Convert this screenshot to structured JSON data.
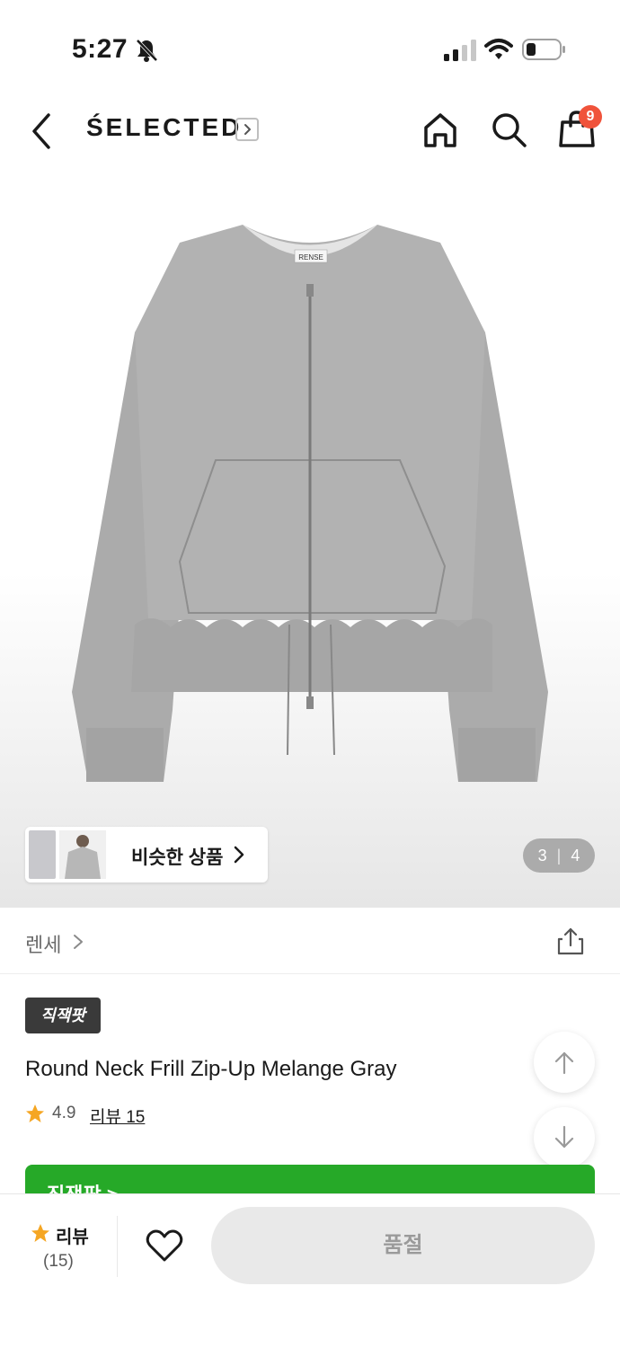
{
  "status_bar": {
    "time": "5:27"
  },
  "header": {
    "brand": "ŚELECTED",
    "cart_count": "9"
  },
  "gallery": {
    "similar_label": "비슷한 상품",
    "current": "3",
    "total": "4",
    "product_label_tag": "RENSE"
  },
  "brand_row": {
    "name": "렌세"
  },
  "product": {
    "tag": "직잭팟",
    "title": "Round Neck Frill Zip-Up Melange Gray",
    "rating": "4.9",
    "review_link": "리뷰 15"
  },
  "banner": {
    "text": "직잭팟 >"
  },
  "bottom_bar": {
    "review_label": "리뷰",
    "review_count": "(15)",
    "soldout_label": "품절"
  },
  "colors": {
    "badge_red": "#f0533b",
    "star_orange": "#f5a623",
    "banner_green": "#26a928",
    "garment_gray": "#a9a9a9"
  }
}
